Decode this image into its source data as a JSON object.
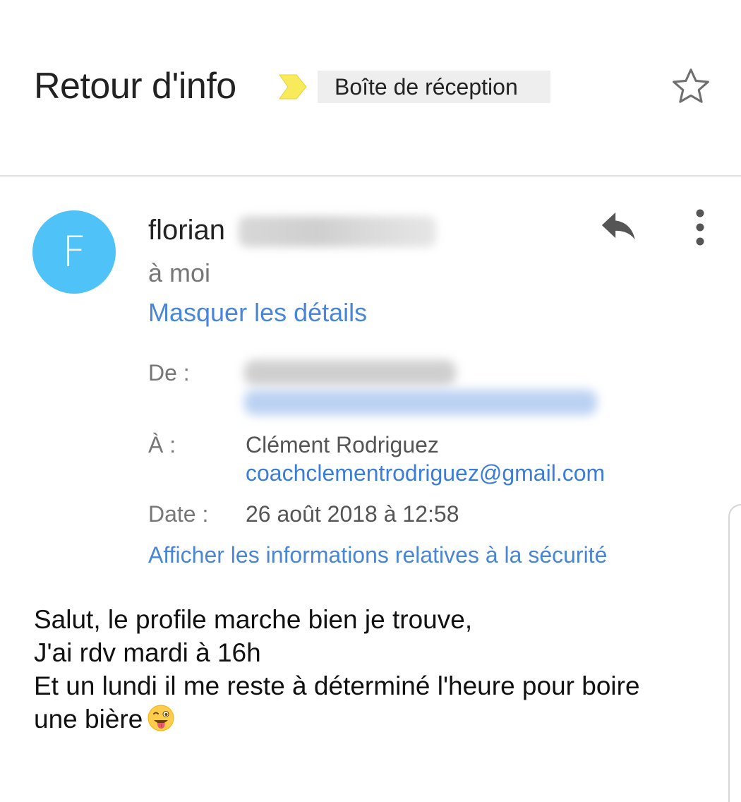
{
  "thread": {
    "subject": "Retour d'info",
    "label": "Boîte de réception",
    "importance_color": "#f9ea5b",
    "starred": false
  },
  "message": {
    "avatar_letter": "F",
    "avatar_color": "#4fc3f7",
    "sender_name": "florian",
    "recipient_summary": "à moi",
    "details_toggle": "Masquer les détails",
    "details": {
      "from_label": "De :",
      "to_label": "À :",
      "to_name": "Clément Rodriguez",
      "to_email": "coachclementrodriguez@gmail.com",
      "date_label": "Date :",
      "date_value": "26 août 2018 à 12:58"
    },
    "security_link": "Afficher les informations relatives à la sécurité",
    "body_lines": [
      "Salut, le profile marche bien je trouve,",
      "J'ai rdv mardi à 16h",
      "Et un lundi il me reste à déterminé l'heure pour boire",
      "une bière"
    ],
    "body_emoji": "winking-face-with-tongue-icon"
  },
  "icons": {
    "importance": "importance-marker-icon",
    "star": "star-icon",
    "reply": "reply-icon",
    "more": "more-vert-icon"
  }
}
